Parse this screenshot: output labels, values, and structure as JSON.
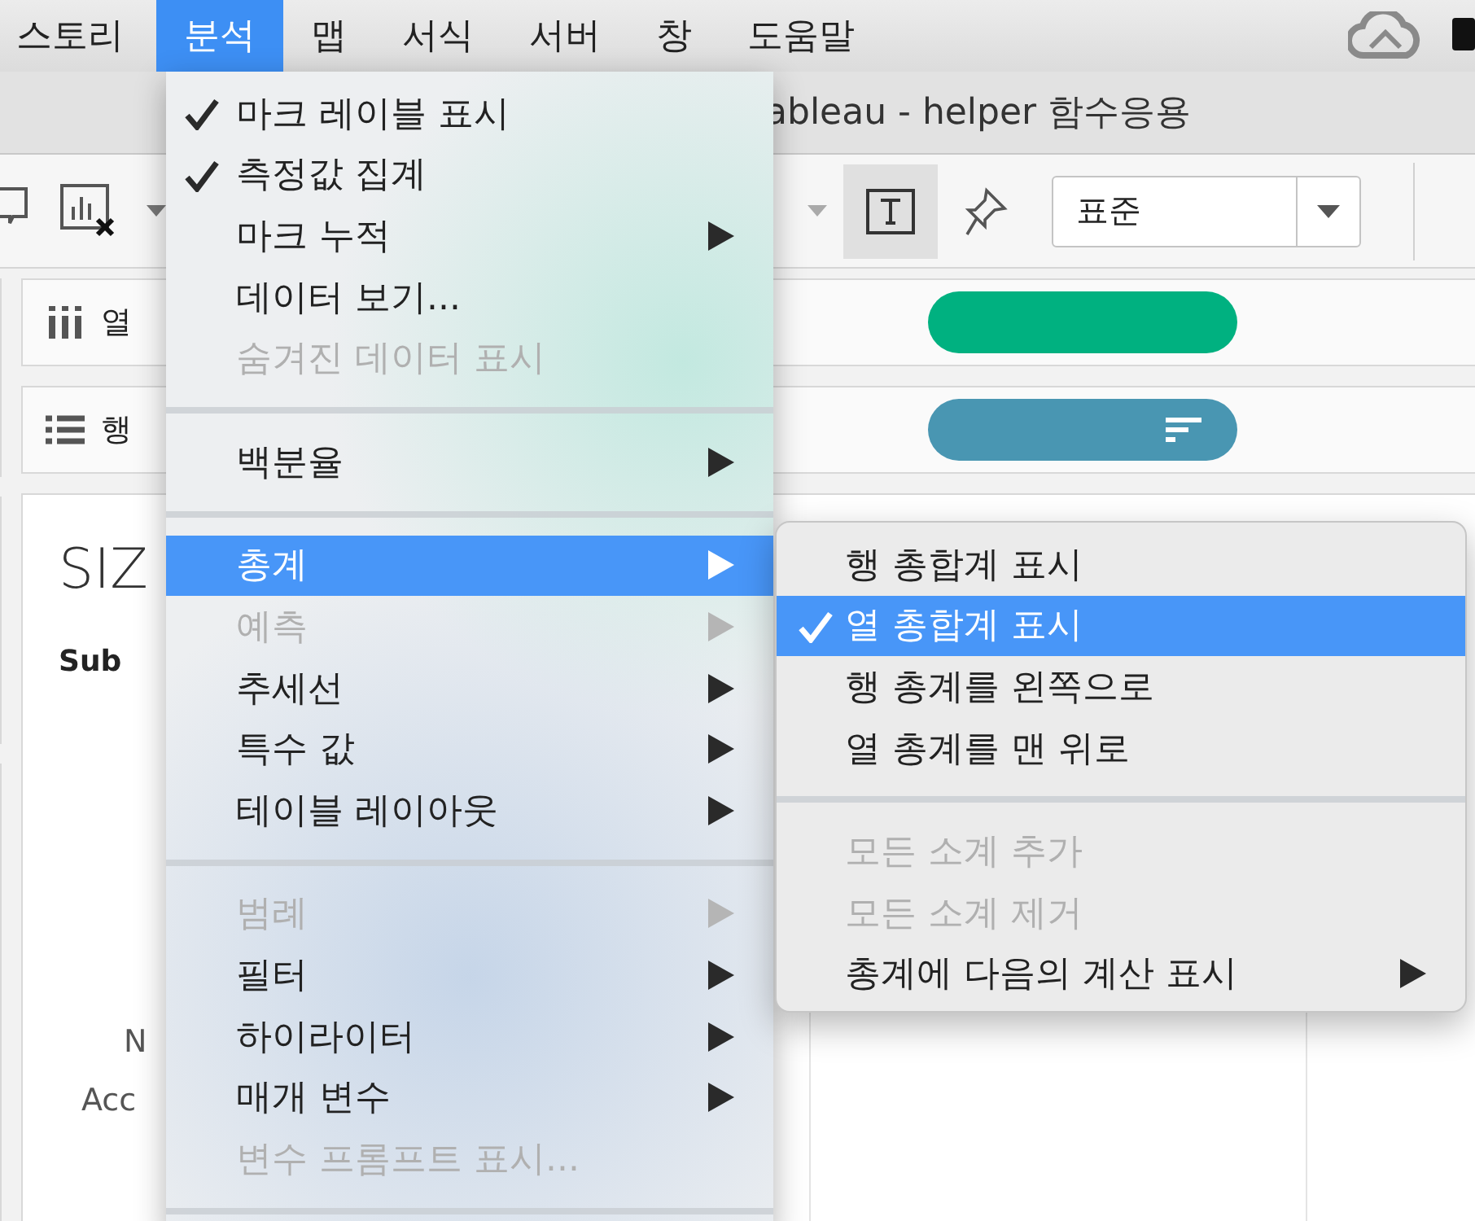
{
  "menu_bar": [
    {
      "label": "스토리",
      "selected": false
    },
    {
      "label": "분석",
      "selected": true
    },
    {
      "label": "맵",
      "selected": false
    },
    {
      "label": "서식",
      "selected": false
    },
    {
      "label": "서버",
      "selected": false
    },
    {
      "label": "창",
      "selected": false
    },
    {
      "label": "도움말",
      "selected": false
    }
  ],
  "window": {
    "title": "ableau - helper 함수응용"
  },
  "toolbar": {
    "mark_type": "표준"
  },
  "shelves": [
    {
      "kind": "columns",
      "label": "열",
      "color": "#00b180"
    },
    {
      "kind": "rows",
      "label": "행",
      "color": "#4996b2"
    }
  ],
  "canvas": {
    "title": "SIZ",
    "subtitle": "Sub",
    "labels": [
      "N",
      "Acc"
    ]
  },
  "analysis_menu": [
    {
      "kind": "item",
      "label": "마크 레이블 표시",
      "checked": true,
      "disabled": false,
      "submenu": false,
      "selected": false
    },
    {
      "kind": "item",
      "label": "측정값 집계",
      "checked": true,
      "disabled": false,
      "submenu": false,
      "selected": false
    },
    {
      "kind": "item",
      "label": "마크 누적",
      "checked": false,
      "disabled": false,
      "submenu": true,
      "selected": false
    },
    {
      "kind": "item",
      "label": "데이터 보기...",
      "checked": false,
      "disabled": false,
      "submenu": false,
      "selected": false
    },
    {
      "kind": "item",
      "label": "숨겨진 데이터 표시",
      "checked": false,
      "disabled": true,
      "submenu": false,
      "selected": false
    },
    {
      "kind": "separator"
    },
    {
      "kind": "item",
      "label": "백분율",
      "checked": false,
      "disabled": false,
      "submenu": true,
      "selected": false
    },
    {
      "kind": "separator"
    },
    {
      "kind": "item",
      "label": "총계",
      "checked": false,
      "disabled": false,
      "submenu": true,
      "selected": true
    },
    {
      "kind": "item",
      "label": "예측",
      "checked": false,
      "disabled": true,
      "submenu": true,
      "selected": false
    },
    {
      "kind": "item",
      "label": "추세선",
      "checked": false,
      "disabled": false,
      "submenu": true,
      "selected": false
    },
    {
      "kind": "item",
      "label": "특수 값",
      "checked": false,
      "disabled": false,
      "submenu": true,
      "selected": false
    },
    {
      "kind": "item",
      "label": "테이블 레이아웃",
      "checked": false,
      "disabled": false,
      "submenu": true,
      "selected": false
    },
    {
      "kind": "separator"
    },
    {
      "kind": "item",
      "label": "범례",
      "checked": false,
      "disabled": true,
      "submenu": true,
      "selected": false
    },
    {
      "kind": "item",
      "label": "필터",
      "checked": false,
      "disabled": false,
      "submenu": true,
      "selected": false
    },
    {
      "kind": "item",
      "label": "하이라이터",
      "checked": false,
      "disabled": false,
      "submenu": true,
      "selected": false
    },
    {
      "kind": "item",
      "label": "매개 변수",
      "checked": false,
      "disabled": false,
      "submenu": true,
      "selected": false
    },
    {
      "kind": "item",
      "label": "변수 프롬프트 표시...",
      "checked": false,
      "disabled": true,
      "submenu": false,
      "selected": false
    },
    {
      "kind": "separator"
    }
  ],
  "totals_submenu": [
    {
      "kind": "item",
      "label": "행 총합계 표시",
      "checked": false,
      "disabled": false,
      "submenu": false,
      "selected": false
    },
    {
      "kind": "item",
      "label": "열 총합계 표시",
      "checked": true,
      "disabled": false,
      "submenu": false,
      "selected": true
    },
    {
      "kind": "item",
      "label": "행 총계를 왼쪽으로",
      "checked": false,
      "disabled": false,
      "submenu": false,
      "selected": false
    },
    {
      "kind": "item",
      "label": "열 총계를 맨 위로",
      "checked": false,
      "disabled": false,
      "submenu": false,
      "selected": false
    },
    {
      "kind": "separator"
    },
    {
      "kind": "item",
      "label": "모든 소계 추가",
      "checked": false,
      "disabled": true,
      "submenu": false,
      "selected": false
    },
    {
      "kind": "item",
      "label": "모든 소계 제거",
      "checked": false,
      "disabled": true,
      "submenu": false,
      "selected": false
    },
    {
      "kind": "item",
      "label": "총계에 다음의 계산 표시",
      "checked": false,
      "disabled": false,
      "submenu": true,
      "selected": false
    }
  ]
}
